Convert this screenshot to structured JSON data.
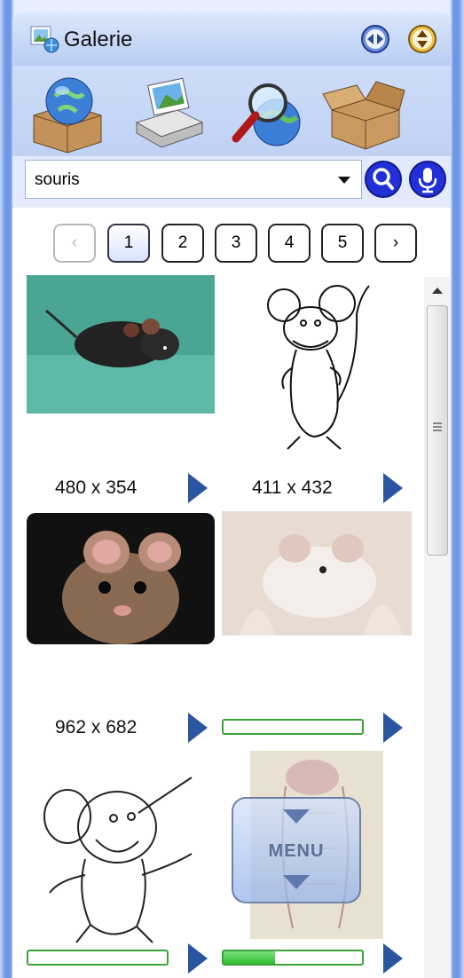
{
  "window": {
    "title": "Galerie",
    "buttons": [
      {
        "icon": "left-right-arrows-icon"
      },
      {
        "icon": "up-down-arrows-icon"
      }
    ]
  },
  "toolbar": {
    "tools": [
      {
        "icon": "globe-box-icon"
      },
      {
        "icon": "scanner-photo-icon"
      },
      {
        "icon": "magnifier-globe-icon"
      },
      {
        "icon": "open-box-icon"
      }
    ]
  },
  "search": {
    "value": "souris",
    "search_icon": "search-icon",
    "mic_icon": "microphone-icon"
  },
  "pager": {
    "prev": "‹",
    "next": "›",
    "pages": [
      "1",
      "2",
      "3",
      "4",
      "5"
    ],
    "current": "1"
  },
  "gallery": {
    "items": [
      {
        "subject": "black mouse on teal background",
        "dims": "480 x 354"
      },
      {
        "subject": "line drawing of cartoon mouse",
        "dims": "411 x 432"
      },
      {
        "subject": "brown mouse close-up",
        "dims": "962 x 682"
      },
      {
        "subject": "white mouse in hand (loading)",
        "progress": 0
      },
      {
        "subject": "cartoon mouse sketch (loading)",
        "progress": 0
      },
      {
        "subject": "pink mouse drawing (loading)",
        "progress": 0.37
      }
    ]
  },
  "menu": {
    "label": "MENU"
  },
  "colors": {
    "frame": "#6f97e6",
    "arrow": "#2a55a0",
    "progress": "#3aa23a"
  }
}
